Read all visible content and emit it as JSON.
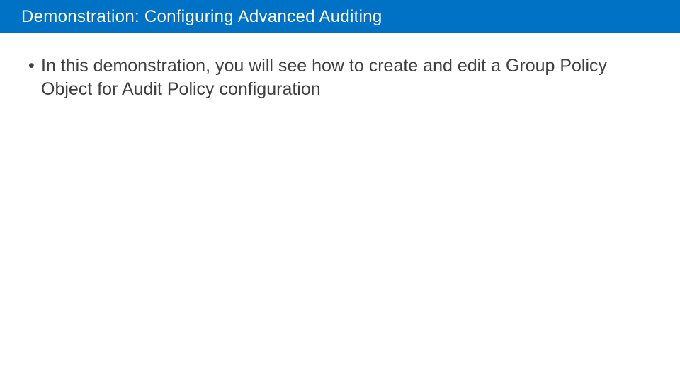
{
  "header": {
    "title": "Demonstration: Configuring Advanced Auditing"
  },
  "content": {
    "bullets": [
      "In this demonstration, you will see how to create and edit a Group Policy Object for Audit Policy configuration"
    ]
  },
  "colors": {
    "header_bg": "#0072c6",
    "header_text": "#ffffff",
    "body_text": "#404040"
  }
}
